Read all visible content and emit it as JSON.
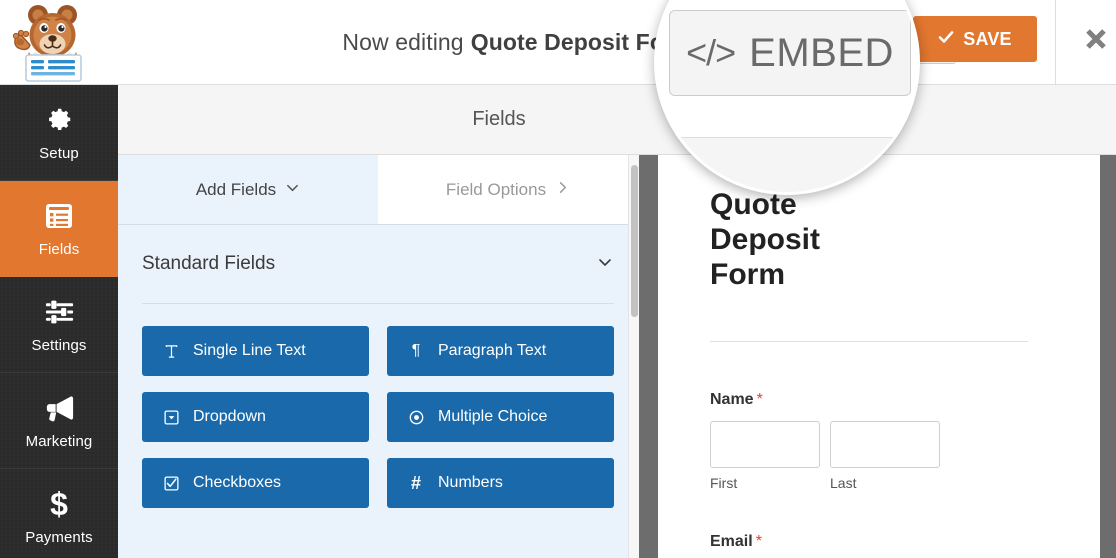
{
  "header": {
    "logo_icon": "wpforms-bear-mascot-logo",
    "editing_prefix": "Now editing",
    "form_name": "Quote Deposit Form",
    "embed_label": "EMBED",
    "embed_icon": "code-brackets-icon",
    "save_label": "SAVE",
    "save_icon": "check-icon",
    "close_icon": "close-x-icon",
    "accent_color": "#e27730"
  },
  "sidebar": {
    "items": [
      {
        "label": "Setup",
        "icon": "gear-icon",
        "active": false
      },
      {
        "label": "Fields",
        "icon": "form-list-icon",
        "active": true
      },
      {
        "label": "Settings",
        "icon": "sliders-icon",
        "active": false
      },
      {
        "label": "Marketing",
        "icon": "megaphone-icon",
        "active": false
      },
      {
        "label": "Payments",
        "icon": "dollar-sign-icon",
        "active": false
      }
    ]
  },
  "page": {
    "title": "Fields"
  },
  "builder": {
    "tabs": [
      {
        "label": "Add Fields",
        "icon": "chevron-down-icon",
        "active": true
      },
      {
        "label": "Field Options",
        "icon": "chevron-right-icon",
        "active": false
      }
    ],
    "section": {
      "title": "Standard Fields",
      "toggle_icon": "chevron-down-icon"
    },
    "fields": [
      {
        "label": "Single Line Text",
        "icon": "text-cursor-icon",
        "glyph": "T"
      },
      {
        "label": "Paragraph Text",
        "icon": "paragraph-icon",
        "glyph": "¶"
      },
      {
        "label": "Dropdown",
        "icon": "dropdown-caret-box-icon",
        "glyph": "▾"
      },
      {
        "label": "Multiple Choice",
        "icon": "radio-button-icon",
        "glyph": "◉"
      },
      {
        "label": "Checkboxes",
        "icon": "checkbox-checked-icon",
        "glyph": "☑"
      },
      {
        "label": "Numbers",
        "icon": "hash-icon",
        "glyph": "#"
      }
    ],
    "field_button_color": "#1a6aab"
  },
  "preview": {
    "form_title": "Quote Deposit Form",
    "fields": [
      {
        "label": "Name",
        "required_marker": "*",
        "sublabels": [
          "First",
          "Last"
        ],
        "values": [
          "",
          ""
        ]
      },
      {
        "label": "Email",
        "required_marker": "*"
      }
    ]
  },
  "zoom_lens": {
    "magnified_target": "embed-button",
    "embed_code_glyph": "</>",
    "embed_label": "EMBED"
  }
}
